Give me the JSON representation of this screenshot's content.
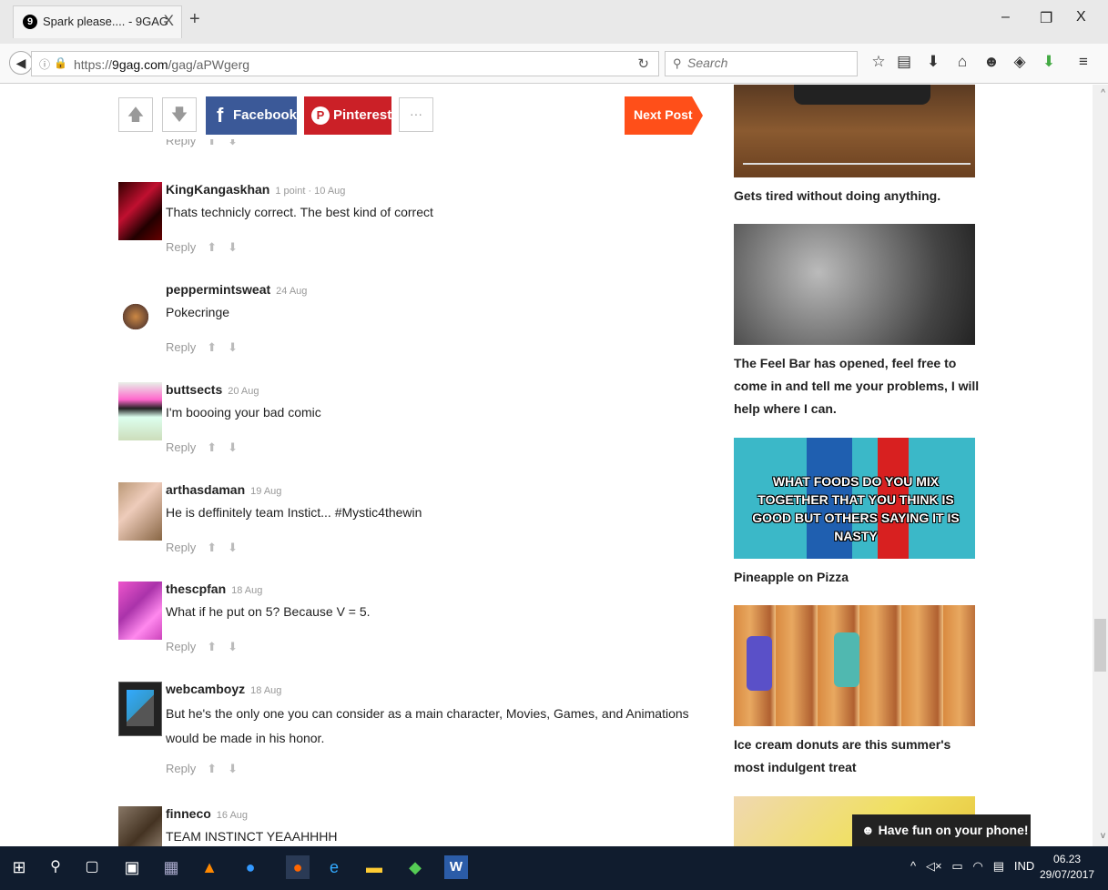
{
  "browser": {
    "tab_title": "Spark please.... - 9GAG",
    "tab_close": "X",
    "new_tab": "+",
    "url_prefix": "https://",
    "url_domain": "9gag.com",
    "url_path": "/gag/aPWgerg",
    "search_placeholder": "Search",
    "window_min": "–",
    "window_restore": "❐",
    "window_close": "X"
  },
  "share_bar": {
    "facebook_label": "Facebook",
    "pinterest_label": "Pinterest",
    "more_label": "···",
    "next_post_label": "Next Post"
  },
  "comments": [
    {
      "name": "",
      "meta": "",
      "text": "",
      "actions": "Reply"
    },
    {
      "name": "KingKangaskhan",
      "meta": "1 point · 10 Aug",
      "text": "Thats technicly correct. The best kind of correct",
      "actions": "Reply"
    },
    {
      "name": "peppermintsweat",
      "meta": "24 Aug",
      "text": "Pokecringe",
      "actions": "Reply"
    },
    {
      "name": "buttsects",
      "meta": "20 Aug",
      "text": "I'm boooing your bad comic",
      "actions": "Reply"
    },
    {
      "name": "arthasdaman",
      "meta": "19 Aug",
      "text": "He is deffinitely team Instict... #Mystic4thewin",
      "actions": "Reply"
    },
    {
      "name": "thescpfan",
      "meta": "18 Aug",
      "text": "What if he put on 5? Because V = 5.",
      "actions": "Reply"
    },
    {
      "name": "webcamboyz",
      "meta": "18 Aug",
      "text": "But he's the only one you can consider as a main character, Movies, Games, and Animations would be made in his honor.",
      "actions": "Reply"
    },
    {
      "name": "finneco",
      "meta": "16 Aug",
      "text": "TEAM INSTINCT YEAAHHHH",
      "actions": ""
    }
  ],
  "sidebar": {
    "items": [
      {
        "title": "Gets tired without doing anything."
      },
      {
        "title": "The Feel Bar has opened, feel free to come in and tell me your problems, I will help where I can."
      },
      {
        "title": "Pineapple on Pizza",
        "image_text": "WHAT FOODS DO YOU MIX TOGETHER THAT YOU THINK IS GOOD BUT OTHERS SAYING IT IS NASTY"
      },
      {
        "title": "Ice cream donuts are this summer's most indulgent treat"
      }
    ],
    "toast": "☻ Have fun on your phone! X"
  },
  "taskbar": {
    "lang": "IND",
    "time": "06.23",
    "date": "29/07/2017"
  },
  "colors": {
    "facebook": "#3b5998",
    "pinterest": "#cb2027",
    "next_post": "#ff4f19",
    "taskbar": "#101c2e"
  }
}
